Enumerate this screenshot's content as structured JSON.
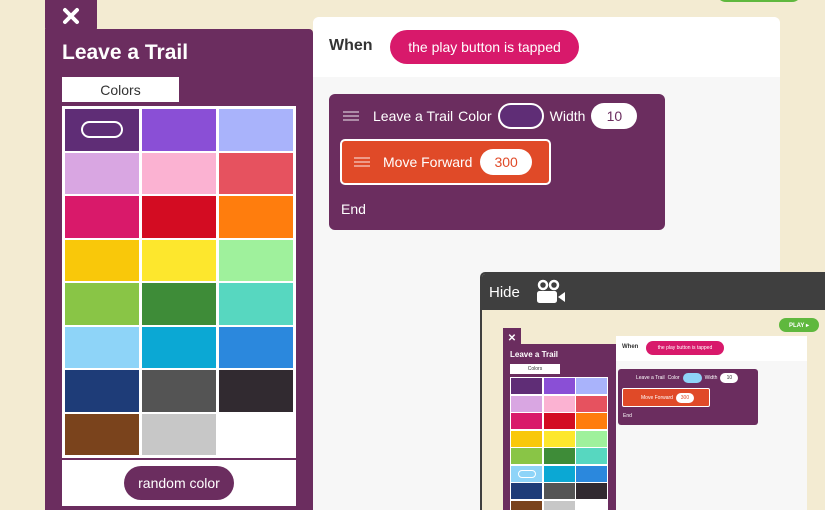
{
  "panel": {
    "title": "Leave a Trail",
    "colors_tab": "Colors",
    "random_button": "random color",
    "swatches": [
      {
        "color": "#5f2d76",
        "selected": true
      },
      {
        "color": "#8a4fd6"
      },
      {
        "color": "#a9b3fb"
      },
      {
        "color": "#d9a6e2"
      },
      {
        "color": "#fbb2d2"
      },
      {
        "color": "#e6525f"
      },
      {
        "color": "#d9196a"
      },
      {
        "color": "#d30c22"
      },
      {
        "color": "#ff7d0d"
      },
      {
        "color": "#f9c80a"
      },
      {
        "color": "#fde72d"
      },
      {
        "color": "#9ff19c"
      },
      {
        "color": "#89c546"
      },
      {
        "color": "#3e8c38"
      },
      {
        "color": "#57d7c0"
      },
      {
        "color": "#8ed4f8"
      },
      {
        "color": "#0ba8d4"
      },
      {
        "color": "#2b88dd"
      },
      {
        "color": "#1e3c78"
      },
      {
        "color": "#545454"
      },
      {
        "color": "#312a30"
      },
      {
        "color": "#7a431c"
      },
      {
        "color": "#c7c7c7"
      },
      {
        "color": "#ffffff"
      }
    ]
  },
  "script": {
    "when_label": "When",
    "trigger": "the play button is tapped",
    "trail_block": {
      "label": "Leave a Trail",
      "color_label": "Color",
      "color_value": "#5f2d76",
      "width_label": "Width",
      "width_value": "10"
    },
    "move_block": {
      "label": "Move Forward",
      "value": "300"
    },
    "end_label": "End"
  },
  "preview": {
    "hide_label": "Hide",
    "play_label": "PLAY ▸",
    "title": "Leave a Trail",
    "colors_tab": "Colors",
    "when_label": "When",
    "trigger": "the play button is tapped",
    "trail_label": "Leave a Trail",
    "color_label": "Color",
    "width_label": "Width",
    "width_value": "10",
    "move_label": "Move Forward",
    "move_value": "300",
    "end_label": "End",
    "swatches": [
      "#5f2d76",
      "#8a4fd6",
      "#a9b3fb",
      "#d9a6e2",
      "#fbb2d2",
      "#e6525f",
      "#d9196a",
      "#d30c22",
      "#ff7d0d",
      "#f9c80a",
      "#fde72d",
      "#9ff19c",
      "#89c546",
      "#3e8c38",
      "#57d7c0",
      "#8ed4f8",
      "#0ba8d4",
      "#2b88dd",
      "#1e3c78",
      "#545454",
      "#312a30",
      "#7a431c",
      "#c7c7c7",
      "#ffffff"
    ],
    "selected_swatch": 15
  },
  "colors": {
    "panel_purple": "#6b2d5f",
    "trigger_pink": "#d8196b",
    "move_orange": "#e04a28",
    "play_green": "#5fb83e"
  }
}
